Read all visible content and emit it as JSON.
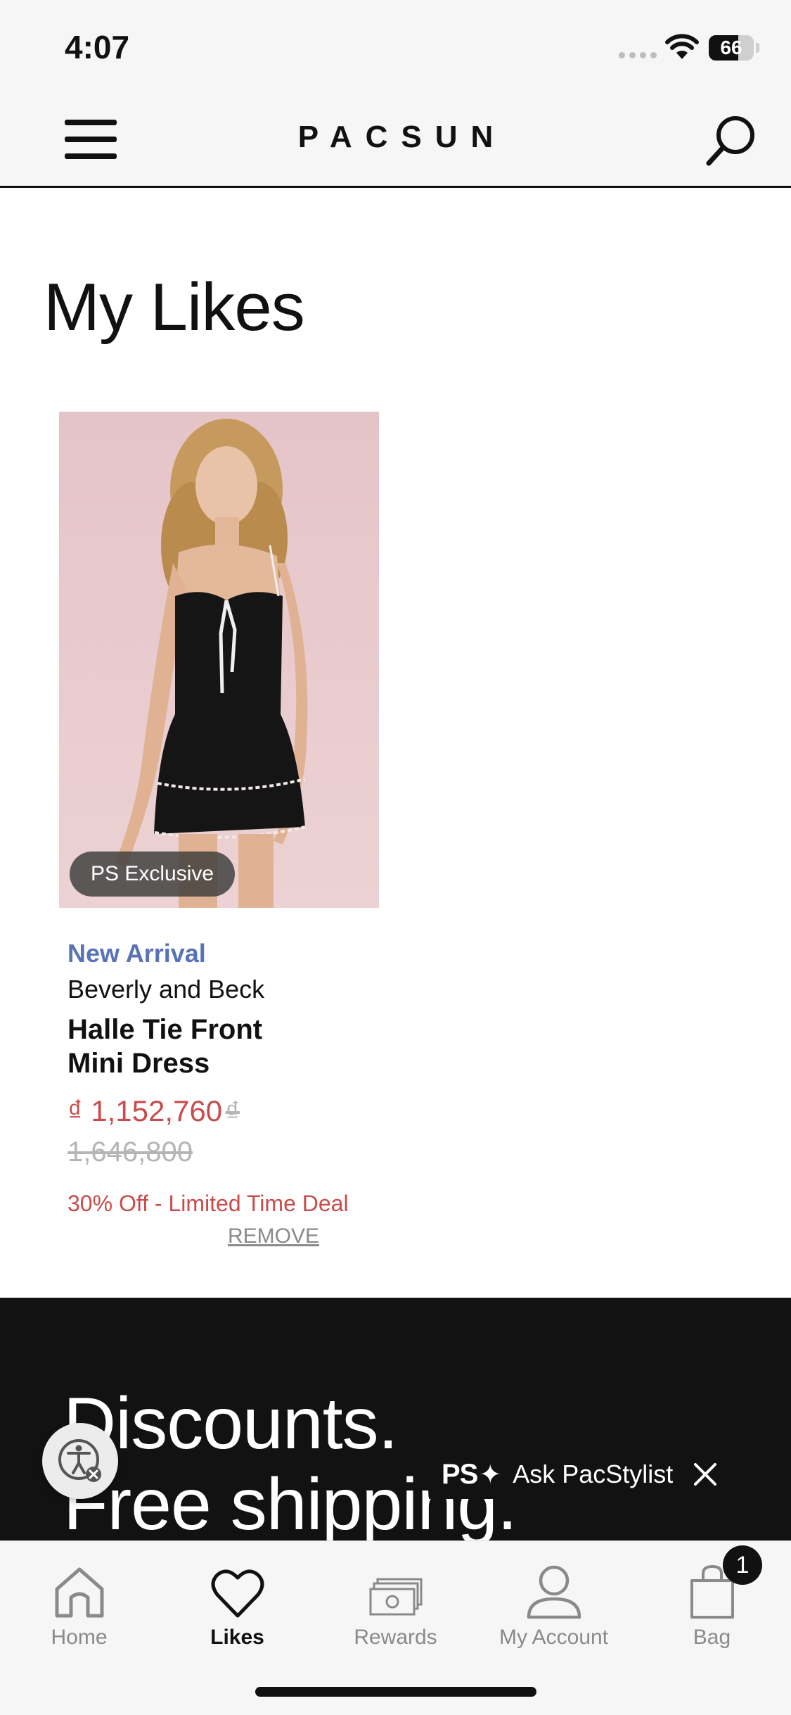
{
  "status_bar": {
    "time": "4:07",
    "battery": "66",
    "battery_level": 0.66
  },
  "header": {
    "logo": "PACSUN"
  },
  "page": {
    "title": "My Likes"
  },
  "product": {
    "badge": "PS Exclusive",
    "tag": "New Arrival",
    "brand": "Beverly and Beck",
    "name": "Halle Tie Front Mini Dress",
    "sale_price": "₫ 1,152,760",
    "original_price": "₫ 1,646,800",
    "deal": "30% Off - Limited Time Deal",
    "remove_label": "REMOVE"
  },
  "promo": {
    "line1": "Discounts.",
    "line2": "Free shipping."
  },
  "stylist": {
    "logo": "PS",
    "label": "Ask PacStylist"
  },
  "tabs": [
    {
      "label": "Home",
      "icon": "home-icon"
    },
    {
      "label": "Likes",
      "icon": "heart-icon",
      "active": true
    },
    {
      "label": "Rewards",
      "icon": "rewards-icon"
    },
    {
      "label": "My Account",
      "icon": "account-icon"
    },
    {
      "label": "Bag",
      "icon": "bag-icon"
    }
  ],
  "bag_count": "1",
  "colors": {
    "accent_blue": "#5a72b8",
    "sale_red": "#c94b4b",
    "dark": "#121212"
  }
}
